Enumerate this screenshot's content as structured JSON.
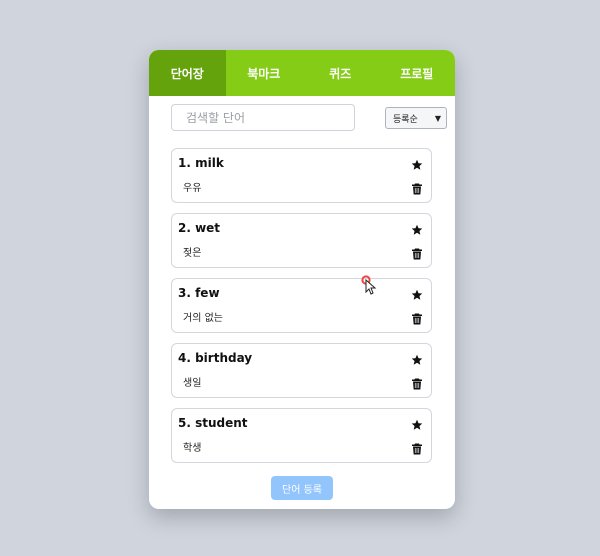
{
  "tabs": [
    {
      "label": "단어장",
      "active": true
    },
    {
      "label": "북마크",
      "active": false
    },
    {
      "label": "퀴즈",
      "active": false
    },
    {
      "label": "프로필",
      "active": false
    }
  ],
  "search": {
    "placeholder": "검색할 단어",
    "value": ""
  },
  "sort": {
    "selected": "등록순"
  },
  "words": [
    {
      "title": "1. milk",
      "meaning": "우유"
    },
    {
      "title": "2. wet",
      "meaning": "젖은"
    },
    {
      "title": "3. few",
      "meaning": "거의 없는"
    },
    {
      "title": "4. birthday",
      "meaning": "생일"
    },
    {
      "title": "5. student",
      "meaning": "학생"
    }
  ],
  "register_button": {
    "label": "단어 등록"
  },
  "icons": {
    "bookmark": "star-icon",
    "delete": "trash-icon"
  },
  "colors": {
    "tab_bar": "#84cc16",
    "tab_active": "#65a30d",
    "register_button": "#93c5fd",
    "background": "#cfd4dd"
  }
}
